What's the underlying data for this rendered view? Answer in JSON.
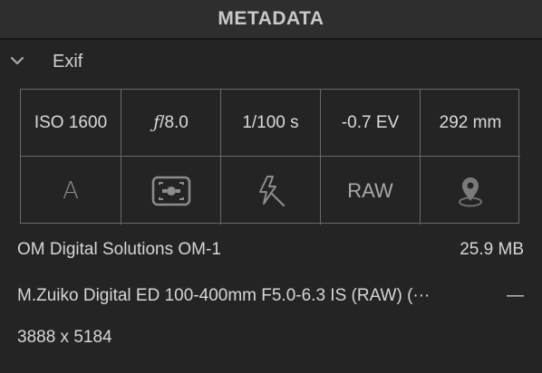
{
  "header": {
    "title": "METADATA"
  },
  "section": {
    "label": "Exif",
    "expanded": true
  },
  "exif": {
    "iso": "ISO 1600",
    "aperture_prefix": "ƒ",
    "aperture_value": "/8.0",
    "shutter": "1/100 s",
    "exposure_comp": "-0.7 EV",
    "focal_length": "292 mm",
    "exposure_mode": "A",
    "metering_icon": "metering-mode-icon",
    "flash_icon": "flash-off-icon",
    "file_format": "RAW",
    "location_icon": "location-pin-icon"
  },
  "camera": {
    "model": "OM Digital Solutions OM-1",
    "file_size": "25.9 MB",
    "lens": "M.Zuiko Digital ED 100-400mm F5.0-6.3 IS (RAW) (···",
    "lens_extra": "—",
    "dimensions": "3888 x 5184"
  },
  "colors": {
    "background": "#242424",
    "header": "#2e2e2e",
    "grid_line": "#6a6a6a",
    "dim_icon": "#8c8c8c"
  }
}
